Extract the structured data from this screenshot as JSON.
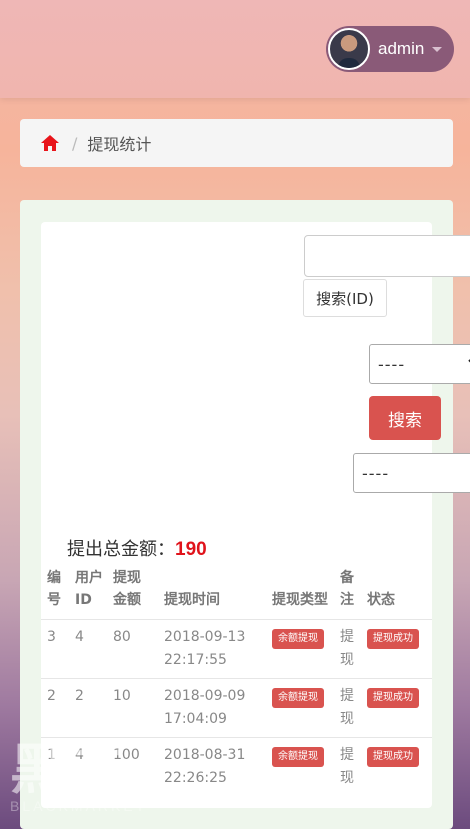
{
  "header": {
    "username": "admin",
    "avatar_icon": "user-avatar",
    "caret_icon": "caret-down-icon"
  },
  "breadcrumb": {
    "home_icon": "home-icon",
    "separator": "/",
    "current": "提现统计"
  },
  "search": {
    "input_value": "",
    "id_button": "搜索(ID)",
    "select1_value": "----",
    "select2_value": "----",
    "search_button": "搜索"
  },
  "summary": {
    "label": "提出总金额：",
    "value": "190"
  },
  "table": {
    "headers": [
      "编号",
      "用户ID",
      "提现金额",
      "提现时间",
      "提现类型",
      "备注",
      "状态"
    ],
    "rows": [
      {
        "id": "3",
        "user_id": "4",
        "amount": "80",
        "time": "2018-09-13 22:17:55",
        "type": "余额提现",
        "note": "提现",
        "status": "提现成功"
      },
      {
        "id": "2",
        "user_id": "2",
        "amount": "10",
        "time": "2018-09-09 17:04:09",
        "type": "余额提现",
        "note": "提现",
        "status": "提现成功"
      },
      {
        "id": "1",
        "user_id": "4",
        "amount": "100",
        "time": "2018-08-31 22:26:25",
        "type": "余额提现",
        "note": "提现",
        "status": "提现成功"
      }
    ]
  },
  "watermark": {
    "big": "黑市",
    "small": "BLACKMARKET"
  },
  "colors": {
    "accent_red": "#d9534f",
    "total_red": "#e0131b",
    "home_red": "#e8141a"
  }
}
